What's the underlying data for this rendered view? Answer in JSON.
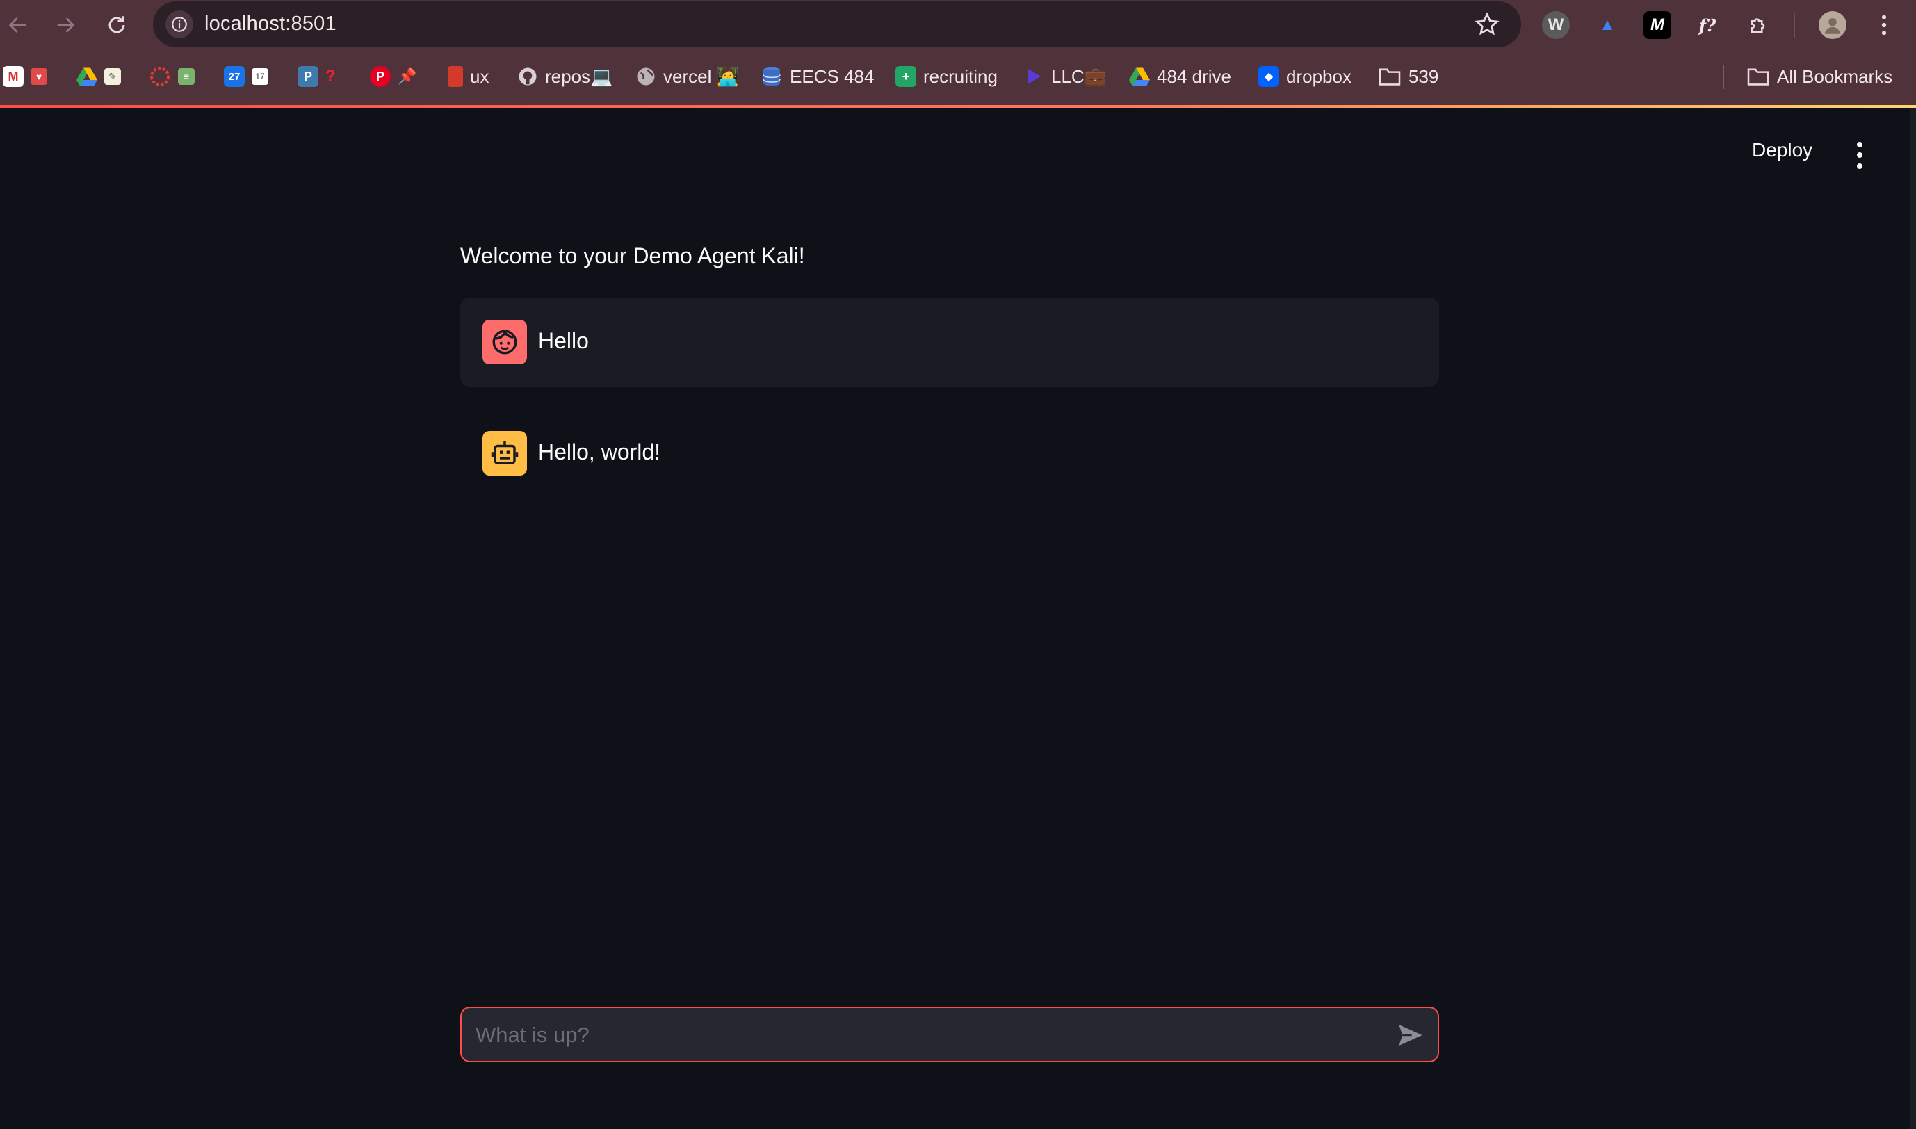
{
  "browser": {
    "url": "localhost:8501",
    "bookmarks": [
      {
        "label": "",
        "icon": "gmail-icon"
      },
      {
        "label": "",
        "icon": "drive-icon"
      },
      {
        "label": "",
        "icon": "canvas-icon"
      },
      {
        "label": "",
        "icon": "calendar-icon"
      },
      {
        "label": "",
        "icon": "piazza-icon"
      },
      {
        "label": "",
        "icon": "pinterest-icon"
      },
      {
        "label": "ux",
        "icon": "book-icon"
      },
      {
        "label": "repos💻",
        "icon": "github-icon"
      },
      {
        "label": "vercel 🧑‍💻",
        "icon": "globe-icon"
      },
      {
        "label": "EECS 484",
        "icon": "database-icon"
      },
      {
        "label": "recruiting",
        "icon": "sheets-icon"
      },
      {
        "label": "LLC💼",
        "icon": "play-icon"
      },
      {
        "label": "484 drive",
        "icon": "drive-icon"
      },
      {
        "label": "dropbox",
        "icon": "dropbox-icon"
      },
      {
        "label": "539",
        "icon": "folder-icon"
      }
    ],
    "all_bookmarks": "All Bookmarks"
  },
  "app": {
    "deploy_label": "Deploy",
    "welcome": "Welcome to your Demo Agent Kali!",
    "messages": [
      {
        "role": "user",
        "text": "Hello",
        "avatar_color": "#ff6c6c"
      },
      {
        "role": "assistant",
        "text": "Hello, world!",
        "avatar_color": "#ffbd45"
      }
    ],
    "input_placeholder": "What is up?",
    "accent_color": "#ff4b4b"
  }
}
